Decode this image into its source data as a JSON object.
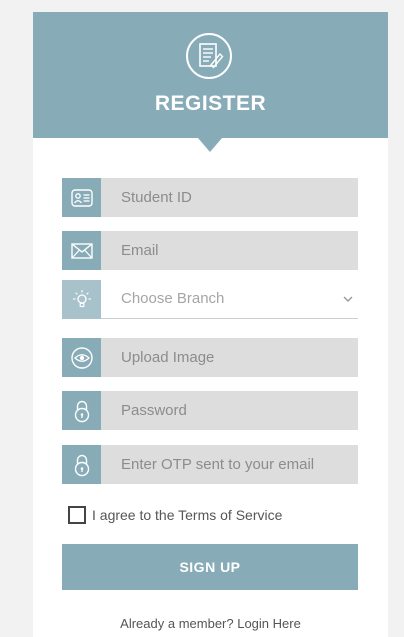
{
  "header": {
    "title": "REGISTER",
    "logo_icon": "register-form-icon"
  },
  "form": {
    "student_id": {
      "placeholder": "Student ID",
      "icon": "id-card-icon"
    },
    "email": {
      "placeholder": "Email",
      "icon": "envelope-icon"
    },
    "branch": {
      "placeholder": "Choose Branch",
      "icon": "bulb-icon"
    },
    "image": {
      "placeholder": "Upload Image",
      "icon": "eye-icon"
    },
    "password": {
      "placeholder": "Password",
      "icon": "lock-icon"
    },
    "otp": {
      "placeholder": "Enter OTP sent to your email",
      "icon": "lock-icon"
    }
  },
  "terms": {
    "label": "I agree to the Terms of Service"
  },
  "signup": {
    "label": "SIGN UP"
  },
  "login": {
    "label": "Already a member? Login Here"
  },
  "colors": {
    "accent": "#88abb8",
    "field_bg": "#dddddd",
    "text": "#555555"
  }
}
